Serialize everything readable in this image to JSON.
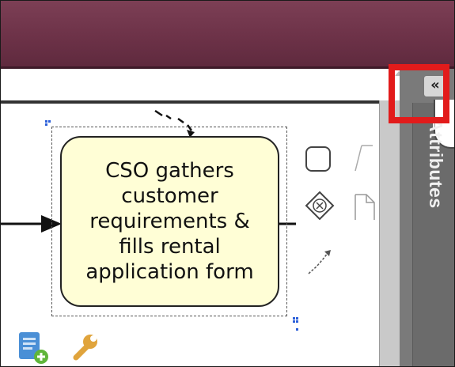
{
  "side_panel": {
    "label": "Attributes",
    "collapse_glyph": "«"
  },
  "task": {
    "text": "CSO gathers customer requirements & fills rental application form"
  },
  "context_pad": {
    "items": [
      "task-icon",
      "gateway-icon",
      "connect-icon",
      "annotation-icon",
      "document-icon"
    ]
  },
  "bottom_toolbar": {
    "items": [
      "add-document-icon",
      "wrench-icon"
    ]
  },
  "colors": {
    "titlebar": "#6d3248",
    "task_fill": "#fffed6",
    "highlight": "#e21b1b",
    "panel": "#7a7a7a"
  }
}
